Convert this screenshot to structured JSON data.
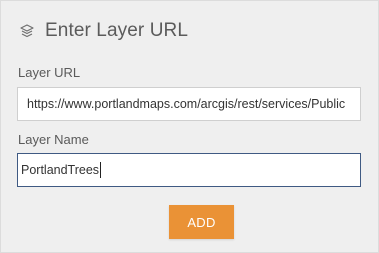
{
  "header": {
    "icon": "layers-icon",
    "title": "Enter Layer URL"
  },
  "layer_url": {
    "label": "Layer URL",
    "value": "https://www.portlandmaps.com/arcgis/rest/services/Public"
  },
  "layer_name": {
    "label": "Layer Name",
    "value": "PortlandTrees"
  },
  "actions": {
    "add_label": "ADD",
    "add_color": "#ea9236"
  }
}
